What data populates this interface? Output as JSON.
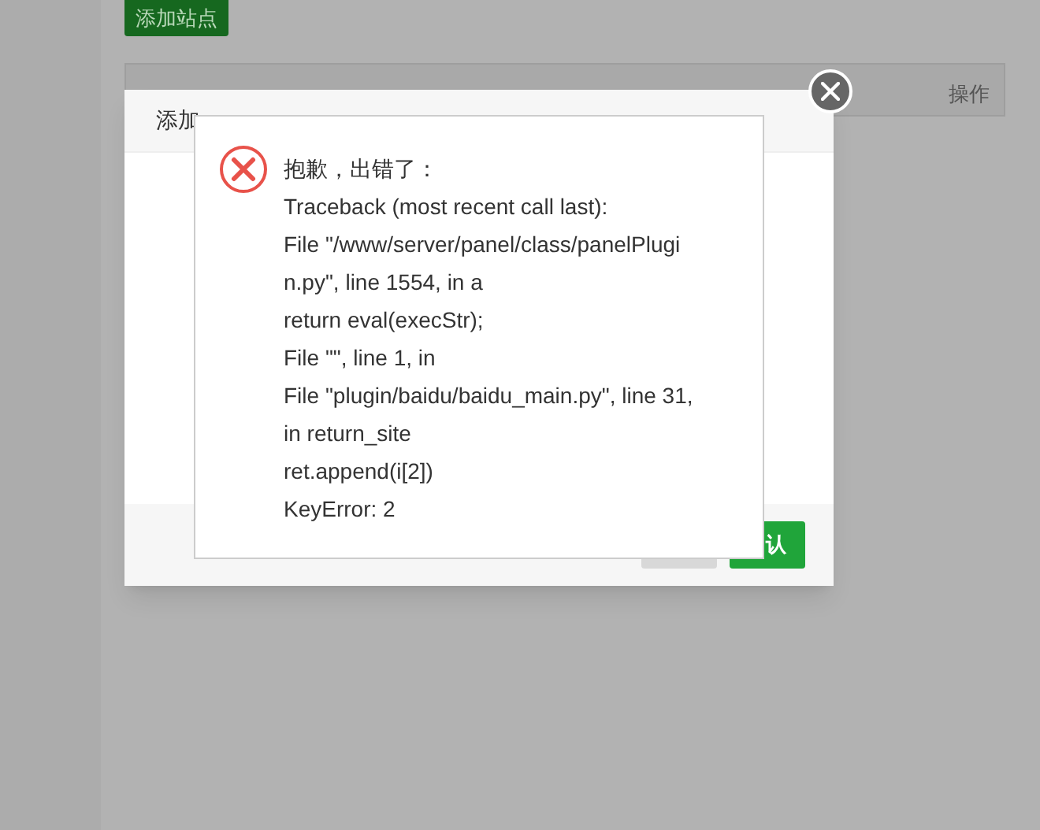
{
  "toolbar": {
    "add_button": "添加站点"
  },
  "table": {
    "columns": [
      "操作"
    ]
  },
  "dialog": {
    "title": "添加",
    "confirm_button": "认"
  },
  "error": {
    "lines": [
      "抱歉，出错了：",
      "Traceback (most recent call last):",
      "File \"/www/server/panel/class/panelPlugi",
      "n.py\", line 1554, in a",
      "return eval(execStr);",
      "File \"\", line 1, in",
      "File \"plugin/baidu/baidu_main.py\", line 31,",
      "in return_site",
      "ret.append(i[2])",
      "KeyError: 2"
    ]
  }
}
